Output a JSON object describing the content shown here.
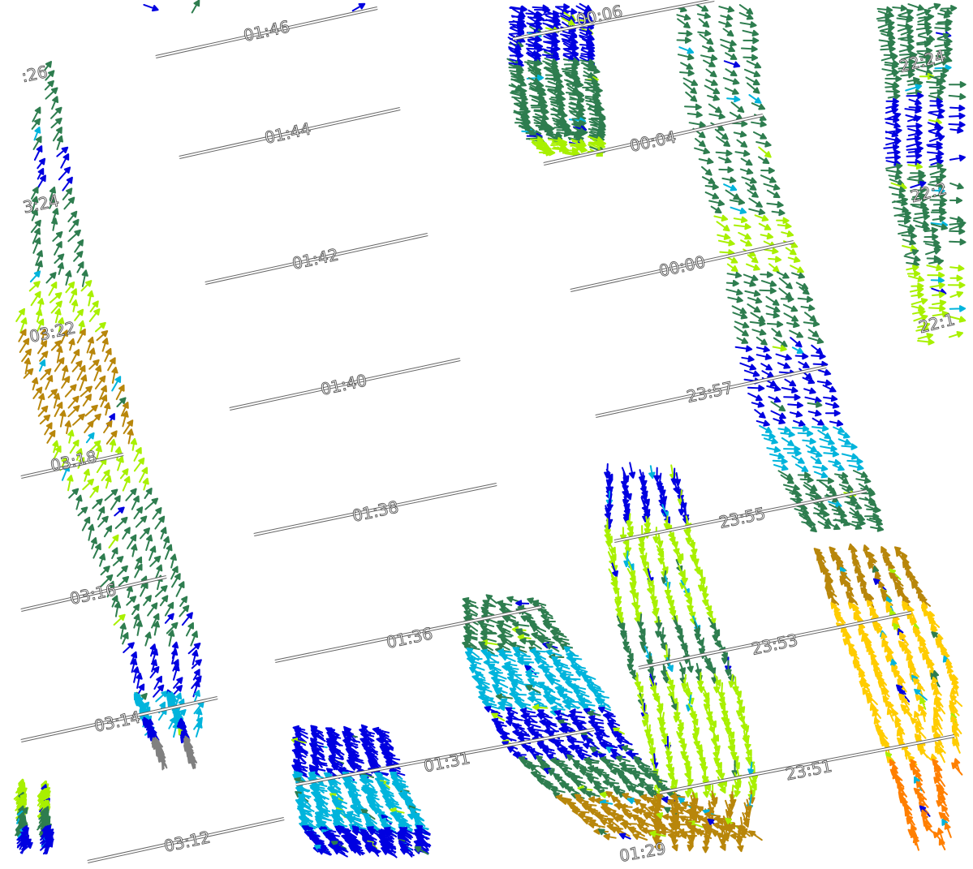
{
  "map": {
    "legend": [],
    "speed_colors": {
      "very_low": "#808080",
      "low": "#0000e0",
      "light": "#00b4dc",
      "moderate": "#2e7d4f",
      "fresh": "#a8f000",
      "strong": "#b8860b",
      "very_strong": "#ffcc00",
      "extreme": "#ff7f00"
    },
    "tracks": [
      {
        "id": "A",
        "labels": [
          "01:46",
          "01:44",
          "01:42",
          "01:40",
          "01:38",
          "01:36",
          "01:31",
          "01:29"
        ]
      },
      {
        "id": "B",
        "labels": [
          "00:06",
          "00:04",
          "00:00",
          "23:57",
          "23:55",
          "23:53",
          "23:51"
        ]
      },
      {
        "id": "C",
        "labels": [
          ":26",
          "3:24",
          "03:22",
          "03:18",
          "03:16",
          "03:14",
          "03:12"
        ]
      },
      {
        "id": "D",
        "labels": [
          "22:24",
          "22:2",
          "22:1"
        ]
      }
    ]
  }
}
